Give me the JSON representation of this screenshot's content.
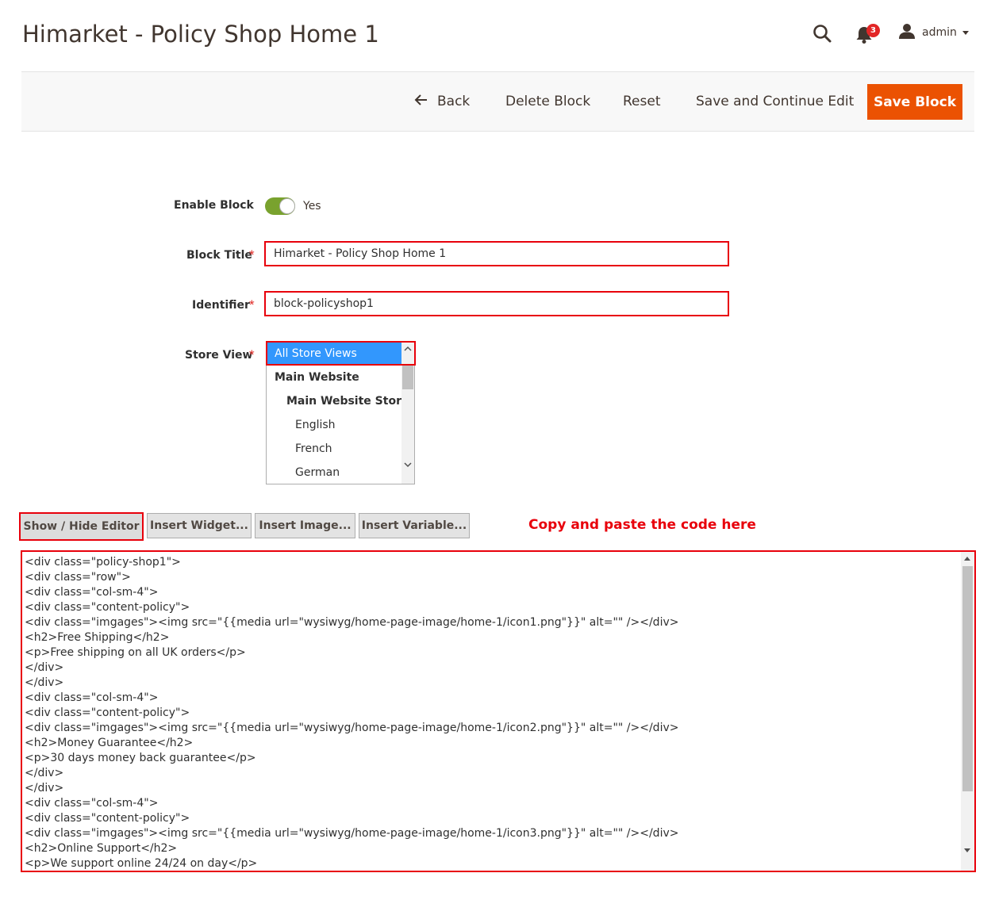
{
  "header": {
    "title": "Himarket - Policy Shop Home 1",
    "notification_count": "3",
    "user_name": "admin",
    "icons": [
      "search-icon",
      "bell-icon",
      "user-icon",
      "chevron-down-icon"
    ]
  },
  "actions": {
    "back_label": "Back",
    "delete_label": "Delete Block",
    "reset_label": "Reset",
    "save_continue_label": "Save and Continue Edit",
    "save_label": "Save Block"
  },
  "form": {
    "enable_label": "Enable Block",
    "enable_value": "Yes",
    "title_label": "Block Title",
    "title_value": "Himarket - Policy Shop Home 1",
    "identifier_label": "Identifier",
    "identifier_value": "block-policyshop1",
    "store_label": "Store View",
    "required_mark": "*",
    "store_options": [
      "All Store Views",
      "Main Website",
      "Main Website Store",
      "English",
      "French",
      "German"
    ],
    "store_selected": "All Store Views"
  },
  "editor": {
    "show_hide_label": "Show / Hide Editor",
    "insert_widget_label": "Insert Widget...",
    "insert_image_label": "Insert Image...",
    "insert_variable_label": "Insert Variable...",
    "hint": "Copy and paste the code here",
    "code_lines": [
      "<div class=\"policy-shop1\">",
      "<div class=\"row\">",
      "<div class=\"col-sm-4\">",
      "<div class=\"content-policy\">",
      "<div class=\"imgages\"><img src=\"{{media url=\"wysiwyg/home-page-image/home-1/icon1.png\"}}\" alt=\"\" /></div>",
      "<h2>Free Shipping</h2>",
      "<p>Free shipping on all UK orders</p>",
      "</div>",
      "</div>",
      "<div class=\"col-sm-4\">",
      "<div class=\"content-policy\">",
      "<div class=\"imgages\"><img src=\"{{media url=\"wysiwyg/home-page-image/home-1/icon2.png\"}}\" alt=\"\" /></div>",
      "<h2>Money Guarantee</h2>",
      "<p>30 days money back guarantee</p>",
      "</div>",
      "</div>",
      "<div class=\"col-sm-4\">",
      "<div class=\"content-policy\">",
      "<div class=\"imgages\"><img src=\"{{media url=\"wysiwyg/home-page-image/home-1/icon3.png\"}}\" alt=\"\" /></div>",
      "<h2>Online Support</h2>",
      "<p>We support online 24/24 on day</p>"
    ]
  },
  "colors": {
    "brand_orange": "#eb5202",
    "highlight_red": "#e8000b",
    "toggle_green": "#79a22e",
    "selected_blue": "#3297fd"
  }
}
